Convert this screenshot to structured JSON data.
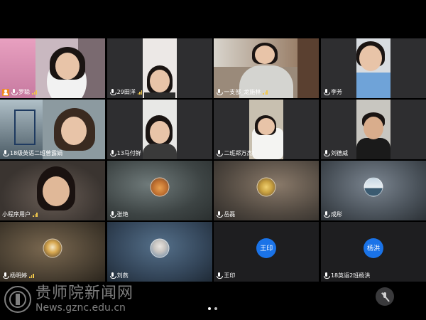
{
  "participants": [
    {
      "name": "罗聪",
      "host": true,
      "signal": true
    },
    {
      "name": "29田洋",
      "signal": true
    },
    {
      "name": "一支部_龙施林",
      "signal": true
    },
    {
      "name": "李芳",
      "signal": false
    },
    {
      "name": "18级英语二班曾露娟",
      "signal": false
    },
    {
      "name": "13马付鲜",
      "signal": false
    },
    {
      "name": "二班郑万杰!",
      "signal": false
    },
    {
      "name": "刘德威",
      "signal": false
    },
    {
      "name": "小程序用户",
      "signal": true
    },
    {
      "name": "张艳",
      "signal": false
    },
    {
      "name": "岳磊",
      "signal": false
    },
    {
      "name": "成彤",
      "signal": false
    },
    {
      "name": "杨明婷",
      "signal": true
    },
    {
      "name": "刘燕",
      "signal": false
    },
    {
      "name": "王印",
      "signal": false,
      "avatar_text": "王印"
    },
    {
      "name": "18英语2班杨洪",
      "signal": false,
      "avatar_text": "杨洪"
    }
  ],
  "watermark": {
    "title": "贵师院新闻网",
    "url": "News.gznc.edu.cn"
  },
  "pager": {
    "pages": 2,
    "current": 1
  },
  "colors": {
    "avatar_blue": "#1a73e8",
    "host_orange": "#f08a24",
    "signal_yellow": "#f2c94c"
  }
}
